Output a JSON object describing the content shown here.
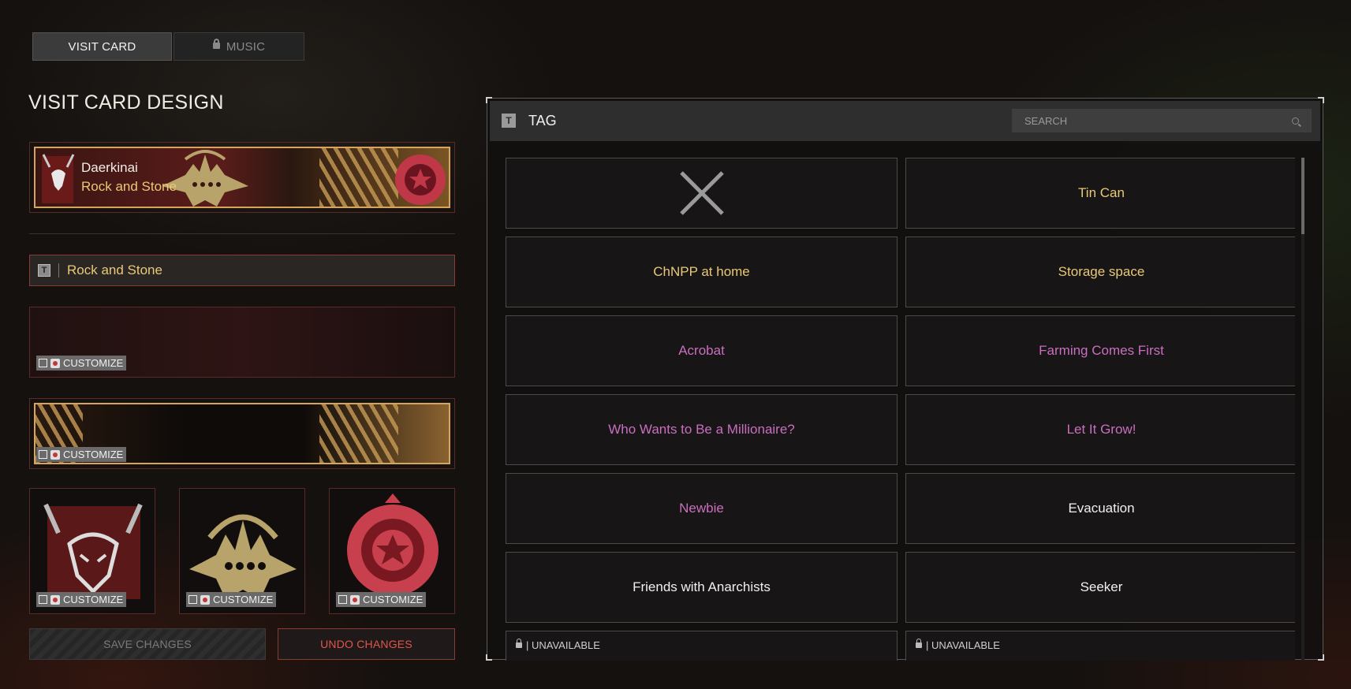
{
  "tabs": [
    {
      "label": "VISIT CARD",
      "active": true,
      "locked": false
    },
    {
      "label": "MUSIC",
      "active": false,
      "locked": true
    }
  ],
  "page_title": "VISIT CARD DESIGN",
  "card": {
    "player_name": "Daerkinai",
    "tag": "Rock and Stone"
  },
  "tag_field": {
    "value": "Rock and Stone"
  },
  "customize_label": "CUSTOMIZE",
  "buttons": {
    "save": "SAVE CHANGES",
    "undo": "UNDO CHANGES"
  },
  "panel": {
    "title": "TAG",
    "search_placeholder": "SEARCH",
    "tags": [
      {
        "label": "",
        "color": "#cccccc",
        "kind": "none"
      },
      {
        "label": "Tin Can",
        "color": "#e9c878",
        "kind": "tag"
      },
      {
        "label": "ChNPP at home",
        "color": "#e9c878",
        "kind": "tag"
      },
      {
        "label": "Storage space",
        "color": "#e9c878",
        "kind": "tag"
      },
      {
        "label": "Acrobat",
        "color": "#c96fc0",
        "kind": "tag"
      },
      {
        "label": "Farming Comes First",
        "color": "#c96fc0",
        "kind": "tag"
      },
      {
        "label": "Who Wants to Be a Millionaire?",
        "color": "#c96fc0",
        "kind": "tag"
      },
      {
        "label": "Let It Grow!",
        "color": "#c96fc0",
        "kind": "tag"
      },
      {
        "label": "Newbie",
        "color": "#c96fc0",
        "kind": "tag"
      },
      {
        "label": "Evacuation",
        "color": "#f0f0f0",
        "kind": "tag"
      },
      {
        "label": "Friends with Anarchists",
        "color": "#f0f0f0",
        "kind": "tag"
      },
      {
        "label": "Seeker",
        "color": "#f0f0f0",
        "kind": "tag"
      },
      {
        "label": "| UNAVAILABLE",
        "color": "#cfcfcf",
        "kind": "unavailable"
      },
      {
        "label": "| UNAVAILABLE",
        "color": "#cfcfcf",
        "kind": "unavailable"
      }
    ]
  },
  "colors": {
    "gold": "#e9c878",
    "rare": "#c96fc0",
    "accent_red": "#e0554a",
    "frame_border": "#5a2a26"
  }
}
